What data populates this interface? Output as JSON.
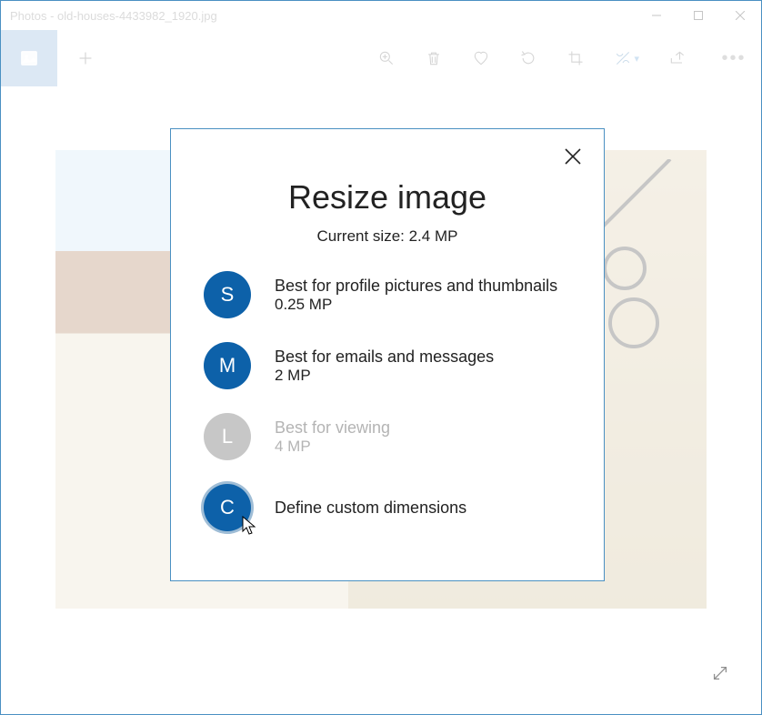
{
  "window_title": "Photos - old-houses-4433982_1920.jpg",
  "dialog": {
    "title": "Resize image",
    "current_size": "Current size: 2.4 MP",
    "options": [
      {
        "badge": "S",
        "label": "Best for profile pictures and thumbnails",
        "sub": "0.25 MP",
        "enabled": true
      },
      {
        "badge": "M",
        "label": "Best for emails and messages",
        "sub": "2 MP",
        "enabled": true
      },
      {
        "badge": "L",
        "label": "Best for viewing",
        "sub": "4 MP",
        "enabled": false
      },
      {
        "badge": "C",
        "label": "Define custom dimensions",
        "sub": "",
        "enabled": true
      }
    ]
  }
}
